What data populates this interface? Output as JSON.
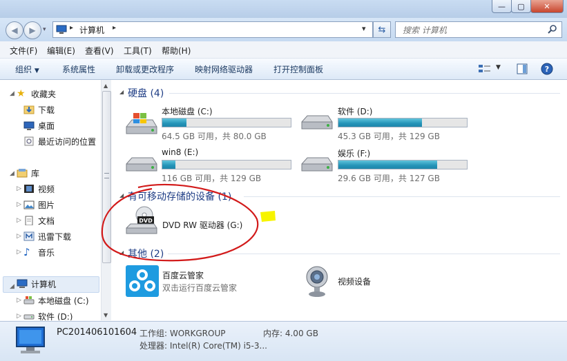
{
  "window": {
    "minimize_glyph": "—",
    "maximize_glyph": "▢",
    "close_glyph": "✕"
  },
  "address": {
    "path_icon": "computer-icon",
    "separator": "▸",
    "crumb": "计算机",
    "crumb_separator": "▸",
    "dropdown": "▾"
  },
  "search": {
    "placeholder": "搜索 计算机"
  },
  "menu": [
    "文件(F)",
    "编辑(E)",
    "查看(V)",
    "工具(T)",
    "帮助(H)"
  ],
  "toolbar": {
    "organize": "组织",
    "items": [
      "系统属性",
      "卸载或更改程序",
      "映射网络驱动器",
      "打开控制面板"
    ]
  },
  "nav": {
    "favorites": "收藏夹",
    "downloads": "下载",
    "desktop": "桌面",
    "recent": "最近访问的位置",
    "libraries": "库",
    "videos": "视频",
    "pictures": "图片",
    "documents": "文档",
    "xunlei": "迅雷下载",
    "music": "音乐",
    "computer": "计算机",
    "drive_c": "本地磁盘 (C:)",
    "drive_d": "软件 (D:)"
  },
  "groups": {
    "hdd": "硬盘 (4)",
    "removable": "有可移动存储的设备 (1)",
    "other": "其他 (2)"
  },
  "drives": [
    {
      "name": "本地磁盘 (C:)",
      "caption": "64.5 GB 可用，共 80.0 GB",
      "used": 0.19
    },
    {
      "name": "软件 (D:)",
      "caption": "45.3 GB 可用，共 129 GB",
      "used": 0.65
    },
    {
      "name": "win8 (E:)",
      "caption": "116 GB 可用，共 129 GB",
      "used": 0.1
    },
    {
      "name": "娱乐 (F:)",
      "caption": "29.6 GB 可用，共 127 GB",
      "used": 0.77
    }
  ],
  "dvd": {
    "name": "DVD RW 驱动器 (G:)",
    "badge": "DVD"
  },
  "others": {
    "baidu_name": "百度云管家",
    "baidu_sub": "双击运行百度云管家",
    "webcam_name": "视频设备"
  },
  "status": {
    "pc_name": "PC201406101604",
    "workgroup": "工作组: WORKGROUP",
    "memory": "内存: 4.00 GB",
    "cpu": "处理器: Intel(R) Core(TM) i5-3..."
  },
  "colors": {
    "accent": "#1e3d85",
    "bar_fill": "#2493b8",
    "annotation_red": "#d21a1a",
    "highlight_yellow": "#f7f400"
  }
}
